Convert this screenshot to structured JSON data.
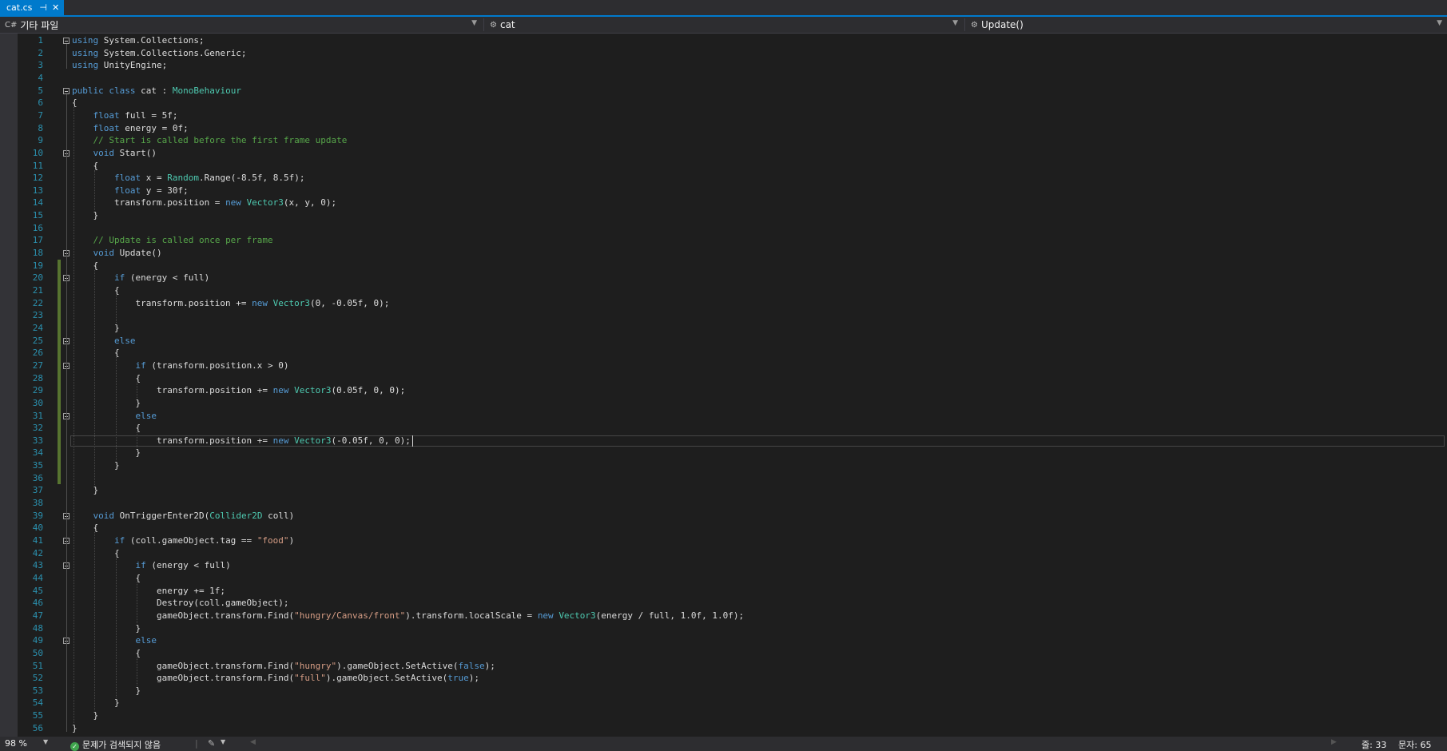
{
  "tab": {
    "filename": "cat.cs",
    "pin_glyph": "⊣",
    "close_glyph": "✕"
  },
  "nav": {
    "project": "기타 파일",
    "project_icon": "C#",
    "class": "cat",
    "member": "Update()"
  },
  "lines": [
    {
      "n": "1",
      "t": "using System.Collections;"
    },
    {
      "n": "2",
      "t": "using System.Collections.Generic;"
    },
    {
      "n": "3",
      "t": "using UnityEngine;"
    },
    {
      "n": "4",
      "t": ""
    },
    {
      "n": "5",
      "t": "public class cat : MonoBehaviour"
    },
    {
      "n": "6",
      "t": "{"
    },
    {
      "n": "7",
      "t": "    float full = 5f;"
    },
    {
      "n": "8",
      "t": "    float energy = 0f;"
    },
    {
      "n": "9",
      "t": "    // Start is called before the first frame update"
    },
    {
      "n": "10",
      "t": "    void Start()"
    },
    {
      "n": "11",
      "t": "    {"
    },
    {
      "n": "12",
      "t": "        float x = Random.Range(-8.5f, 8.5f);"
    },
    {
      "n": "13",
      "t": "        float y = 30f;"
    },
    {
      "n": "14",
      "t": "        transform.position = new Vector3(x, y, 0);"
    },
    {
      "n": "15",
      "t": "    }"
    },
    {
      "n": "16",
      "t": ""
    },
    {
      "n": "17",
      "t": "    // Update is called once per frame"
    },
    {
      "n": "18",
      "t": "    void Update()"
    },
    {
      "n": "19",
      "t": "    {"
    },
    {
      "n": "20",
      "t": "        if (energy < full)"
    },
    {
      "n": "21",
      "t": "        {"
    },
    {
      "n": "22",
      "t": "            transform.position += new Vector3(0, -0.05f, 0);"
    },
    {
      "n": "23",
      "t": ""
    },
    {
      "n": "24",
      "t": "        }"
    },
    {
      "n": "25",
      "t": "        else"
    },
    {
      "n": "26",
      "t": "        {"
    },
    {
      "n": "27",
      "t": "            if (transform.position.x > 0)"
    },
    {
      "n": "28",
      "t": "            {"
    },
    {
      "n": "29",
      "t": "                transform.position += new Vector3(0.05f, 0, 0);"
    },
    {
      "n": "30",
      "t": "            }"
    },
    {
      "n": "31",
      "t": "            else"
    },
    {
      "n": "32",
      "t": "            {"
    },
    {
      "n": "33",
      "t": "                transform.position += new Vector3(-0.05f, 0, 0);"
    },
    {
      "n": "34",
      "t": "            }"
    },
    {
      "n": "35",
      "t": "        }"
    },
    {
      "n": "36",
      "t": ""
    },
    {
      "n": "37",
      "t": "    }"
    },
    {
      "n": "38",
      "t": ""
    },
    {
      "n": "39",
      "t": "    void OnTriggerEnter2D(Collider2D coll)"
    },
    {
      "n": "40",
      "t": "    {"
    },
    {
      "n": "41",
      "t": "        if (coll.gameObject.tag == \"food\")"
    },
    {
      "n": "42",
      "t": "        {"
    },
    {
      "n": "43",
      "t": "            if (energy < full)"
    },
    {
      "n": "44",
      "t": "            {"
    },
    {
      "n": "45",
      "t": "                energy += 1f;"
    },
    {
      "n": "46",
      "t": "                Destroy(coll.gameObject);"
    },
    {
      "n": "47",
      "t": "                gameObject.transform.Find(\"hungry/Canvas/front\").transform.localScale = new Vector3(energy / full, 1.0f, 1.0f);"
    },
    {
      "n": "48",
      "t": "            }"
    },
    {
      "n": "49",
      "t": "            else"
    },
    {
      "n": "50",
      "t": "            {"
    },
    {
      "n": "51",
      "t": "                gameObject.transform.Find(\"hungry\").gameObject.SetActive(false);"
    },
    {
      "n": "52",
      "t": "                gameObject.transform.Find(\"full\").gameObject.SetActive(true);"
    },
    {
      "n": "53",
      "t": "            }"
    },
    {
      "n": "54",
      "t": "        }"
    },
    {
      "n": "55",
      "t": "    }"
    },
    {
      "n": "56",
      "t": "}"
    }
  ],
  "status": {
    "zoom": "98 %",
    "issues": "문제가 검색되지 않음",
    "line_label": "줄: 33",
    "col_label": "문자: 65"
  },
  "colors": {
    "accent": "#007acc",
    "keyword": "#569cd6",
    "type": "#4ec9b0",
    "comment": "#57a64a",
    "string": "#d69d85",
    "line_number": "#2b91af"
  }
}
